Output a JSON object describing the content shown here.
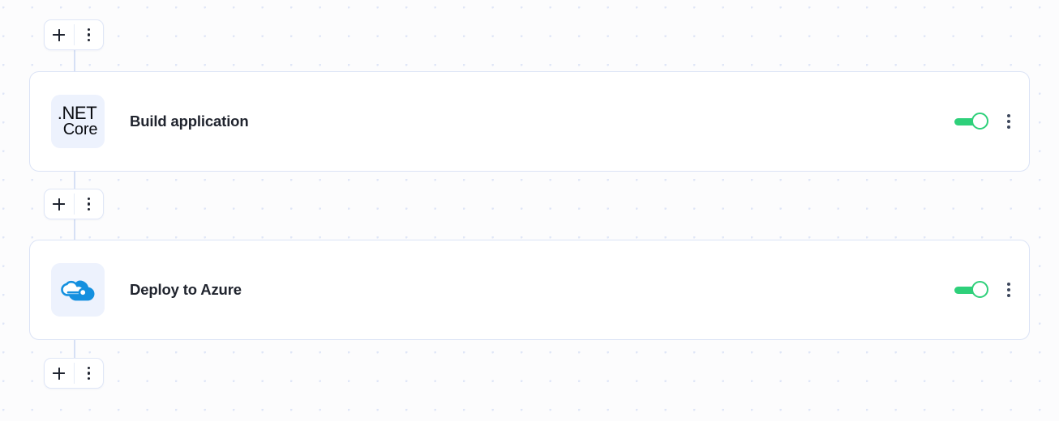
{
  "canvas": {
    "background_color": "#fcfcfd",
    "grid_dot_color": "#dfe6f7",
    "connector_color": "#d6e0f5"
  },
  "toolbar_nodes": [
    {
      "id": "add-node-top",
      "add_label": "+",
      "add_icon": "plus-icon",
      "menu_icon": "kebab-menu-icon"
    },
    {
      "id": "add-node-middle",
      "add_label": "+",
      "add_icon": "plus-icon",
      "menu_icon": "kebab-menu-icon"
    },
    {
      "id": "add-node-bottom",
      "add_label": "+",
      "add_icon": "plus-icon",
      "menu_icon": "kebab-menu-icon"
    }
  ],
  "steps": [
    {
      "id": "build-application",
      "title": "Build application",
      "icon": {
        "name": "dotnet-core-icon",
        "line1": ".NET",
        "line2": "Core",
        "background": "#edf2fd"
      },
      "toggle": {
        "name": "enabled-toggle",
        "state": "on",
        "color": "#2ed07a"
      },
      "menu_icon": "kebab-menu-icon"
    },
    {
      "id": "deploy-to-azure",
      "title": "Deploy to Azure",
      "icon": {
        "name": "azure-cloud-icon",
        "background": "#edf2fd",
        "color": "#0f8ce0"
      },
      "toggle": {
        "name": "enabled-toggle",
        "state": "on",
        "color": "#2ed07a"
      },
      "menu_icon": "kebab-menu-icon"
    }
  ]
}
